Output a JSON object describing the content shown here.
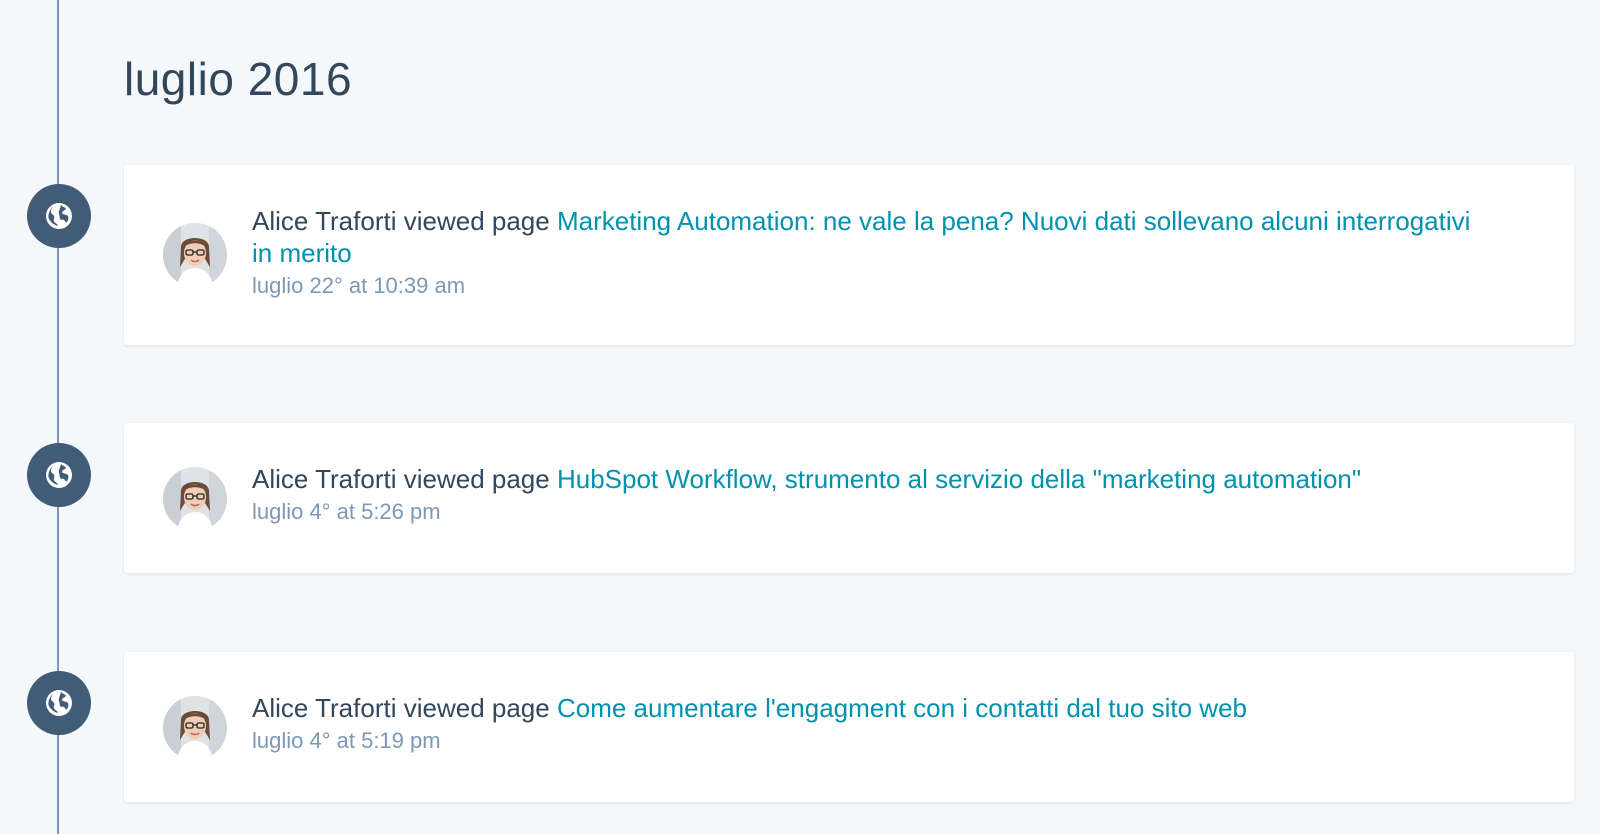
{
  "timeline": {
    "month_heading": "luglio 2016",
    "events": [
      {
        "actor": "Alice Traforti",
        "action": "viewed page",
        "page_title": "Marketing Automation: ne vale la pena? Nuovi dati sollevano alcuni interrogativi in merito",
        "timestamp": "luglio 22° at 10:39 am",
        "icon": "globe-icon"
      },
      {
        "actor": "Alice Traforti",
        "action": "viewed page",
        "page_title": "HubSpot Workflow, strumento al servizio della \"marketing automation\"",
        "timestamp": "luglio 4° at 5:26 pm",
        "icon": "globe-icon"
      },
      {
        "actor": "Alice Traforti",
        "action": "viewed page",
        "page_title": "Come aumentare l'engagment con i contatti dal tuo sito web",
        "timestamp": "luglio 4° at 5:19 pm",
        "icon": "globe-icon"
      }
    ]
  },
  "colors": {
    "background": "#f5f8fa",
    "timeline_node": "#425b76",
    "link": "#0091ae",
    "text": "#33475b",
    "muted": "#7c98b6"
  }
}
